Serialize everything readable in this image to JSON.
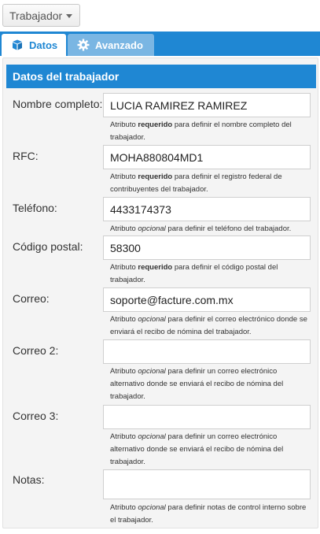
{
  "toolbar": {
    "dropdown_label": "Trabajador"
  },
  "tabs": [
    {
      "label": "Datos",
      "icon": "cube-icon",
      "active": true
    },
    {
      "label": "Avanzado",
      "icon": "gear-icon",
      "active": false
    }
  ],
  "panel": {
    "title": "Datos del trabajador",
    "fields": [
      {
        "label": "Nombre completo:",
        "value": "LUCIA RAMIREZ RAMIREZ",
        "hint_pre": "Atributo ",
        "hint_kw": "requerido",
        "hint_post": " para definir el nombre completo del trabajador."
      },
      {
        "label": "RFC:",
        "value": "MOHA880804MD1",
        "hint_pre": "Atributo ",
        "hint_kw": "requerido",
        "hint_post": " para definir el registro federal de contribuyentes del trabajador."
      },
      {
        "label": "Teléfono:",
        "value": "4433174373",
        "hint_pre": "Atributo ",
        "hint_kw": "opcional",
        "hint_post": " para definir el teléfono del trabajador."
      },
      {
        "label": "Código postal:",
        "value": "58300",
        "hint_pre": "Atributo ",
        "hint_kw": "requerido",
        "hint_post": " para definir el código postal del trabajador."
      },
      {
        "label": "Correo:",
        "value": "soporte@facture.com.mx",
        "hint_pre": "Atributo ",
        "hint_kw": "opcional",
        "hint_post": " para definir el correo electrónico donde se enviará el recibo de nómina del trabajador."
      },
      {
        "label": "Correo 2:",
        "value": "",
        "hint_pre": "Atributo ",
        "hint_kw": "opcional",
        "hint_post": " para definir un correo electrónico alternativo donde se enviará el recibo de nómina del trabajador."
      },
      {
        "label": "Correo 3:",
        "value": "",
        "hint_pre": "Atributo ",
        "hint_kw": "opcional",
        "hint_post": " para definir un correo electrónico alternativo donde se enviará el recibo de nómina del trabajador."
      },
      {
        "label": "Notas:",
        "value": "",
        "hint_pre": "Atributo ",
        "hint_kw": "opcional",
        "hint_post": " para definir notas de control interno sobre el trabajador."
      }
    ]
  },
  "colors": {
    "accent": "#1f87d3",
    "tab_inactive": "#7ab6e3",
    "panel_bg": "#f4f4f4"
  }
}
